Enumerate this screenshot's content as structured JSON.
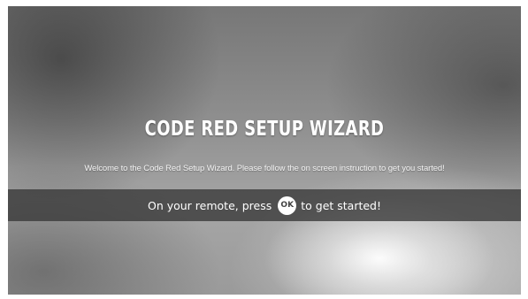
{
  "wizard": {
    "title": "CODE RED SETUP WIZARD",
    "welcome_text": "Welcome to the Code Red Setup Wizard. Please follow the on screen instruction to get you started!",
    "prompt_before": "On your remote, press",
    "ok_label": "OK",
    "prompt_after": "to get started!"
  }
}
